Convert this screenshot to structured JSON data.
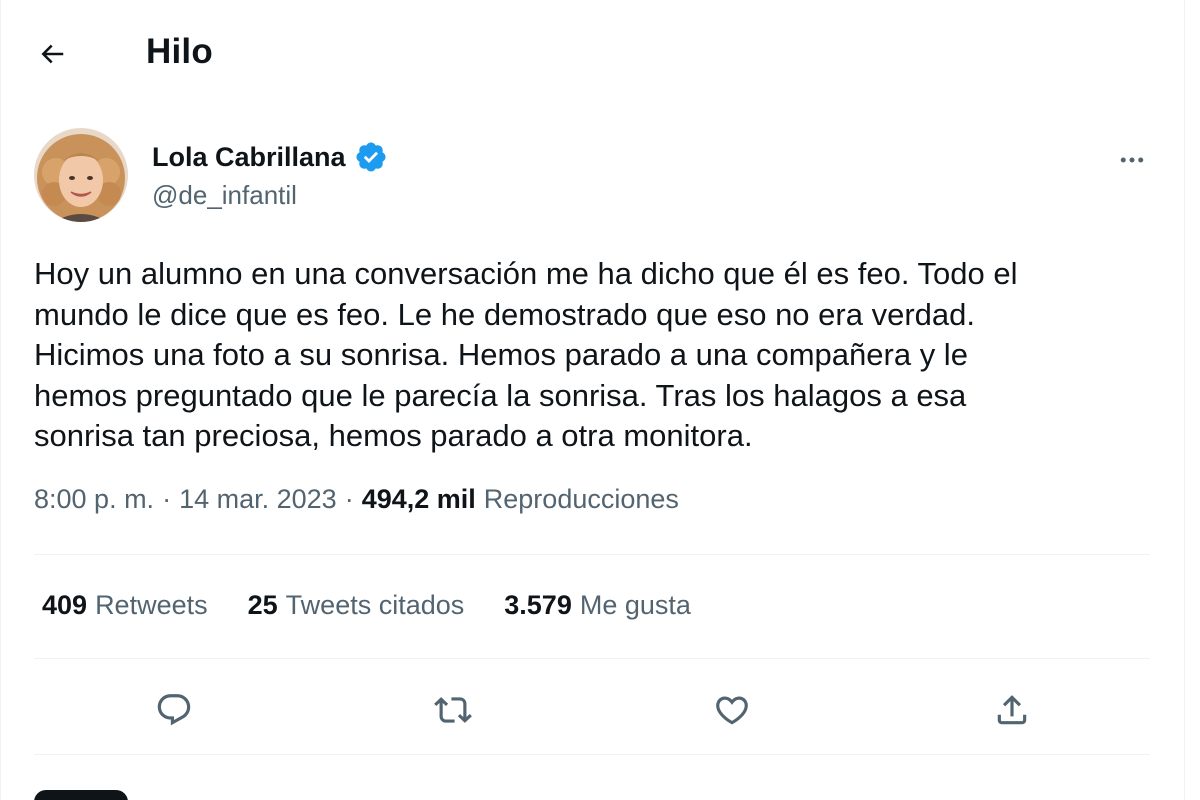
{
  "header": {
    "title": "Hilo",
    "back_icon": "arrow-left-icon"
  },
  "author": {
    "display_name": "Lola Cabrillana",
    "handle": "@de_infantil",
    "verified_color": "#1d9bf0",
    "avatar_icon": "user-avatar",
    "more_icon": "more-horizontal-icon"
  },
  "tweet": {
    "lines": [
      "Hoy un alumno en una conversación me ha dicho que él es feo. Todo el",
      "mundo le dice que es feo. Le he demostrado que eso no era verdad.",
      "Hicimos una foto a su sonrisa. Hemos parado a una compañera y le",
      "hemos preguntado que le parecía la sonrisa. Tras los halagos a esa",
      "sonrisa tan preciosa, hemos parado a otra monitora."
    ],
    "time": "8:00 p. m.",
    "separator": "·",
    "date": "14 mar. 2023",
    "views_count": "494,2 mil",
    "views_label": "Reproducciones"
  },
  "stats": {
    "retweets_count": "409",
    "retweets_label": "Retweets",
    "quotes_count": "25",
    "quotes_label": "Tweets citados",
    "likes_count": "3.579",
    "likes_label": "Me gusta"
  },
  "actions": {
    "reply_icon": "reply-icon",
    "retweet_icon": "retweet-icon",
    "like_icon": "heart-icon",
    "share_icon": "share-icon"
  },
  "colors": {
    "text_primary": "#0f1419",
    "text_secondary": "#536471",
    "divider": "#eff3f4",
    "accent": "#1d9bf0"
  }
}
